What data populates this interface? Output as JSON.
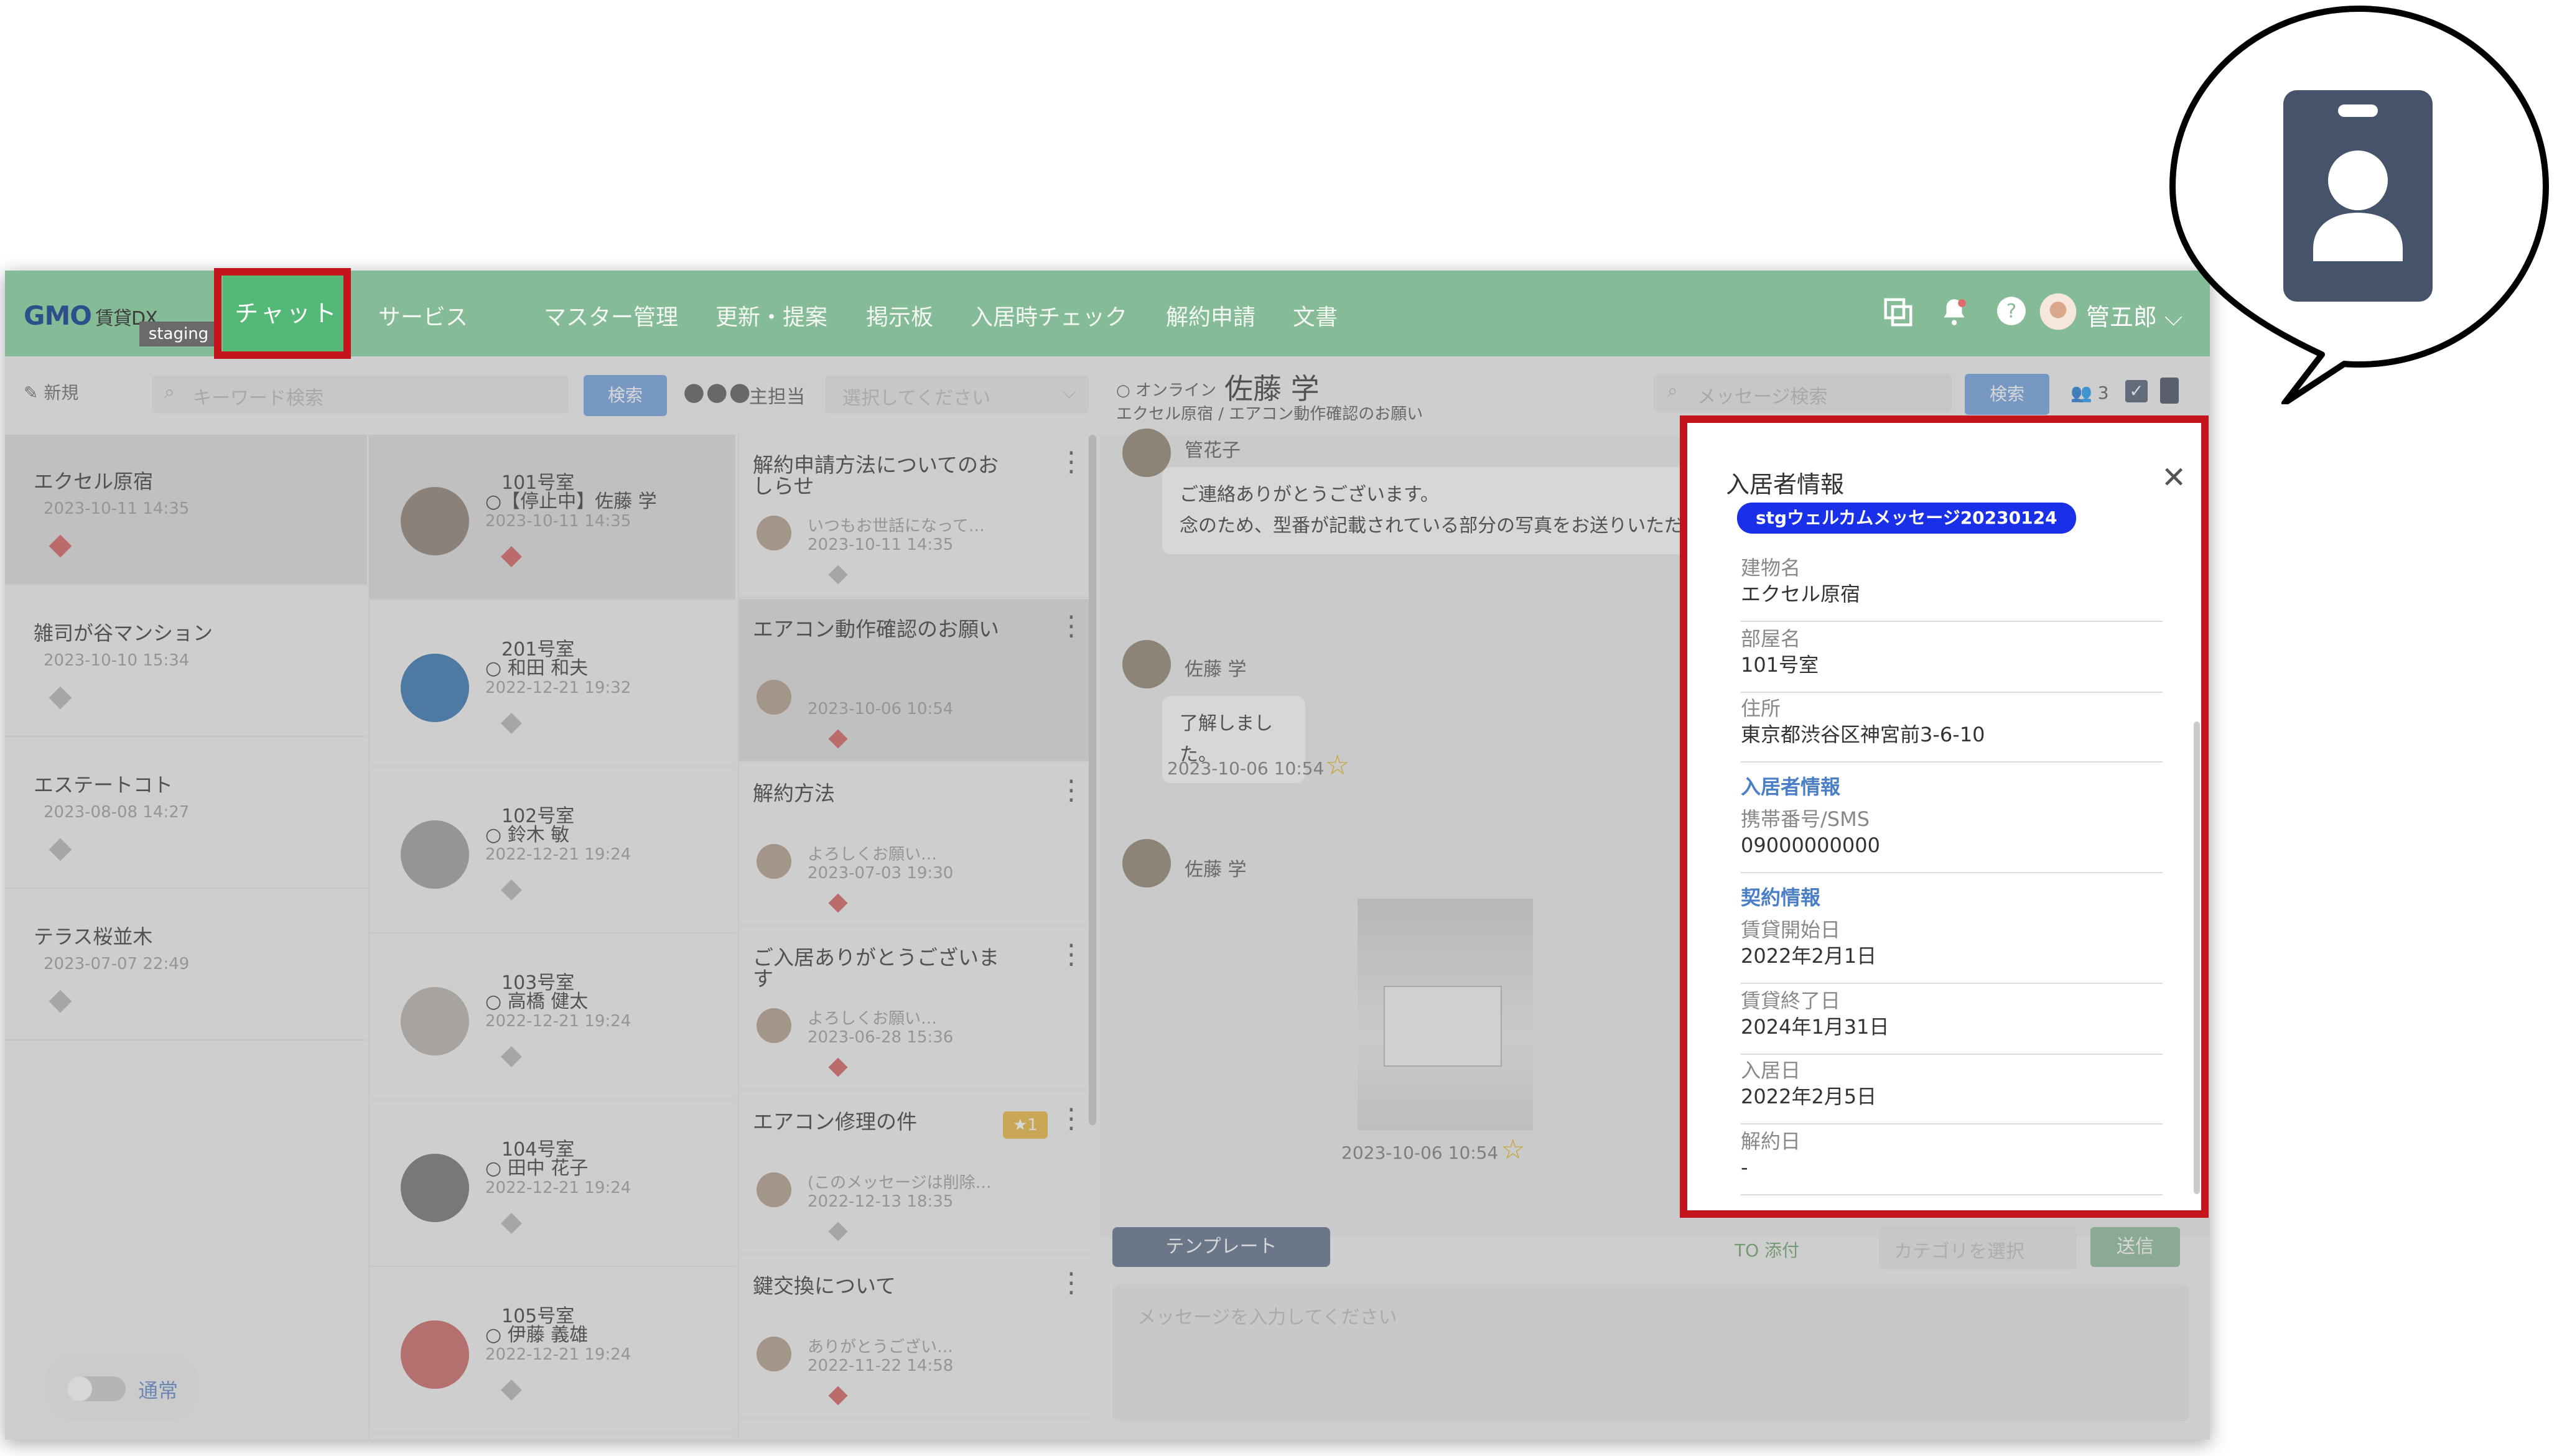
{
  "topbar": {
    "logo_main": "GMO",
    "logo_sub": "賃貸DX",
    "staging": "staging",
    "nav": [
      "チャット",
      "サービス",
      "マスター管理",
      "更新・提案",
      "掲示板",
      "入居時チェック",
      "解約申請",
      "文書"
    ],
    "user_name": "管五郎"
  },
  "left": {
    "new_label": "新規",
    "search_placeholder": "キーワード検索",
    "search_button": "検索",
    "buildings": [
      {
        "name": "エクセル原宿",
        "date": "2023-10-11 14:35"
      },
      {
        "name": "雑司が谷マンション",
        "date": "2023-10-10 15:34"
      },
      {
        "name": "エステートコト",
        "date": "2023-08-08 14:27"
      },
      {
        "name": "テラス桜並木",
        "date": "2023-07-07 22:49"
      }
    ],
    "mode_label": "通常"
  },
  "rooms": [
    {
      "room": "101号室",
      "who": "○【停止中】佐藤 学",
      "date": "2023-10-11 14:35"
    },
    {
      "room": "201号室",
      "who": "○ 和田 和夫",
      "date": "2022-12-21 19:32"
    },
    {
      "room": "102号室",
      "who": "○ 鈴木 敏",
      "date": "2022-12-21 19:24"
    },
    {
      "room": "103号室",
      "who": "○ 高橋 健太",
      "date": "2022-12-21 19:24"
    },
    {
      "room": "104号室",
      "who": "○ 田中 花子",
      "date": "2022-12-21 19:24"
    },
    {
      "room": "105号室",
      "who": "○ 伊藤 義雄",
      "date": "2022-12-21 19:24"
    }
  ],
  "threads_header": {
    "staff_label": "主担当",
    "staff_placeholder": "選択してください"
  },
  "threads": [
    {
      "title": "解約申請方法についてのおしらせ",
      "preview": "いつもお世話になって…",
      "date": "2023-10-11 14:35"
    },
    {
      "title": "エアコン動作確認のお願い",
      "preview": "",
      "date": "2023-10-06 10:54"
    },
    {
      "title": "解約方法",
      "preview": "よろしくお願い…",
      "date": "2023-07-03 19:30"
    },
    {
      "title": "ご入居ありがとうございます",
      "preview": "よろしくお願い…",
      "date": "2023-06-28 15:36"
    },
    {
      "title": "エアコン修理の件",
      "preview": "(このメッセージは削除…",
      "date": "2022-12-13 18:35",
      "badge": "★1"
    },
    {
      "title": "鍵交換について",
      "preview": "ありがとうござい…",
      "date": "2022-11-22 14:58"
    }
  ],
  "chat": {
    "online": "○ オンライン",
    "name": "佐藤 学",
    "subtitle": "エクセル原宿 / エアコン動作確認のお願い",
    "search_placeholder": "メッセージ検索",
    "search_button": "検索",
    "member_count": "3",
    "cut_sender": "管花子",
    "msg1_line1": "ご連絡ありがとうございます。",
    "msg1_line2": "念のため、型番が記載されている部分の写真をお送りいただけ",
    "sender": "佐藤 学",
    "msg2": "了解しました。",
    "ts1": "2023-10-06 10:54",
    "ts2": "2023-10-06 10:54",
    "template_button": "テンプレート",
    "to_attach": "TO  添付",
    "category_placeholder": "カテゴリを選択",
    "send_button": "送信",
    "input_placeholder": "メッセージを入力してください"
  },
  "panel": {
    "title": "入居者情報",
    "tag": "stgウェルカムメッセージ20230124",
    "fields_a": [
      {
        "k": "建物名",
        "v": "エクセル原宿"
      },
      {
        "k": "部屋名",
        "v": "101号室"
      },
      {
        "k": "住所",
        "v": "東京都渋谷区神宮前3-6-10"
      }
    ],
    "section_resident": "入居者情報",
    "phone_label": "携帯番号/SMS",
    "phone": "09000000000",
    "section_contract": "契約情報",
    "fields_b": [
      {
        "k": "賃貸開始日",
        "v": "2022年2月1日"
      },
      {
        "k": "賃貸終了日",
        "v": "2024年1月31日"
      },
      {
        "k": "入居日",
        "v": "2022年2月5日"
      },
      {
        "k": "解約日",
        "v": "-"
      }
    ]
  },
  "colors": {
    "header_green": "#86bb97",
    "active_green": "#54b977",
    "highlight_red": "#c4141c",
    "tag_blue": "#1a2fe8",
    "callout_icon": "#45536b"
  },
  "icons": [
    "copy-icon",
    "bell-icon",
    "help-icon",
    "contact-card-icon",
    "checkbox-icon",
    "members-icon",
    "search-icon",
    "close-icon"
  ]
}
